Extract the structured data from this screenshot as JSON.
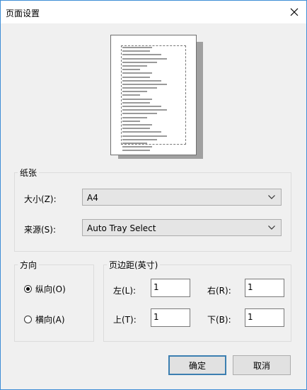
{
  "window": {
    "title": "页面设置"
  },
  "paper": {
    "group_label": "纸张",
    "size_label": "大小(Z):",
    "size_value": "A4",
    "source_label": "来源(S):",
    "source_value": "Auto Tray Select"
  },
  "orientation": {
    "group_label": "方向",
    "portrait_label": "纵向(O)",
    "landscape_label": "横向(A)",
    "selected": "portrait"
  },
  "margins": {
    "group_label": "页边距(英寸)",
    "left_label": "左(L):",
    "left_value": "1",
    "right_label": "右(R):",
    "right_value": "1",
    "top_label": "上(T):",
    "top_value": "1",
    "bottom_label": "下(B):",
    "bottom_value": "1"
  },
  "buttons": {
    "ok": "确定",
    "cancel": "取消"
  }
}
